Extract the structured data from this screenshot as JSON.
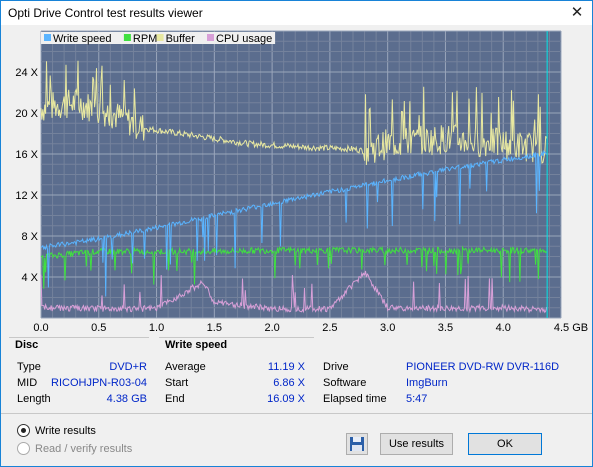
{
  "window": {
    "title": "Opti Drive Control test results viewer",
    "close_glyph": "✕"
  },
  "legend": [
    {
      "label": "Write speed",
      "color": "#5ab4ff"
    },
    {
      "label": "RPM",
      "color": "#40e040"
    },
    {
      "label": "Buffer",
      "color": "#e8e8a0"
    },
    {
      "label": "CPU usage",
      "color": "#d8a0d8"
    }
  ],
  "chart_data": {
    "type": "line",
    "xlabel_unit": "GB",
    "xlim": [
      0,
      4.5
    ],
    "ylim": [
      0,
      28
    ],
    "x_ticks": [
      "0.0",
      "0.5",
      "1.0",
      "1.5",
      "2.0",
      "2.5",
      "3.0",
      "3.5",
      "4.0",
      "4.5 GB"
    ],
    "y_ticks": [
      "4 X",
      "8 X",
      "12 X",
      "16 X",
      "20 X",
      "24 X"
    ],
    "grid": true,
    "end_marker_x": 4.38,
    "series": [
      {
        "name": "Write speed",
        "x": [
          0.0,
          0.5,
          1.0,
          1.5,
          2.0,
          2.5,
          3.0,
          3.5,
          4.0,
          4.38
        ],
        "values": [
          6.86,
          7.7,
          8.8,
          10.0,
          11.2,
          12.3,
          13.4,
          14.5,
          15.4,
          16.09
        ]
      },
      {
        "name": "RPM",
        "x": [
          0.0,
          0.5,
          1.0,
          1.5,
          2.0,
          2.5,
          3.0,
          3.5,
          4.0,
          4.38
        ],
        "values": [
          6.0,
          6.5,
          6.5,
          6.5,
          6.6,
          6.6,
          6.6,
          6.6,
          6.6,
          6.6
        ]
      },
      {
        "name": "Buffer",
        "x": [
          0.0,
          0.3,
          0.6,
          0.9,
          1.2,
          1.5,
          1.8,
          2.1,
          2.4,
          2.7,
          2.8,
          3.0,
          3.5,
          4.0,
          4.38
        ],
        "values": [
          20.5,
          21.0,
          20.0,
          18.5,
          18.0,
          17.5,
          17.0,
          16.8,
          16.6,
          16.5,
          16.3,
          17.0,
          17.5,
          17.0,
          16.5
        ]
      },
      {
        "name": "CPU usage",
        "x": [
          0.0,
          0.5,
          1.0,
          1.4,
          1.5,
          2.0,
          2.5,
          2.8,
          3.0,
          3.5,
          4.0,
          4.38
        ],
        "values": [
          1.0,
          0.9,
          0.9,
          3.5,
          1.5,
          0.9,
          0.9,
          4.5,
          1.0,
          0.9,
          1.0,
          0.8
        ]
      }
    ]
  },
  "disc": {
    "header": "Disc",
    "rows": [
      {
        "label": "Type",
        "value": "DVD+R"
      },
      {
        "label": "MID",
        "value": "RICOHJPN-R03-04"
      },
      {
        "label": "Length",
        "value": "4.38 GB"
      }
    ]
  },
  "write_speed": {
    "header": "Write speed",
    "rows": [
      {
        "label": "Average",
        "value": "11.19 X"
      },
      {
        "label": "Start",
        "value": "6.86 X"
      },
      {
        "label": "End",
        "value": "16.09 X"
      }
    ]
  },
  "drive_info": {
    "rows": [
      {
        "label": "Drive",
        "value": "PIONEER  DVD-RW  DVR-116D"
      },
      {
        "label": "Software",
        "value": "ImgBurn"
      },
      {
        "label": "Elapsed time",
        "value": "5:47"
      }
    ]
  },
  "options": {
    "write_results": "Write results",
    "read_verify": "Read / verify results"
  },
  "buttons": {
    "use_results": "Use results",
    "ok": "OK",
    "save_icon": "save-icon"
  }
}
